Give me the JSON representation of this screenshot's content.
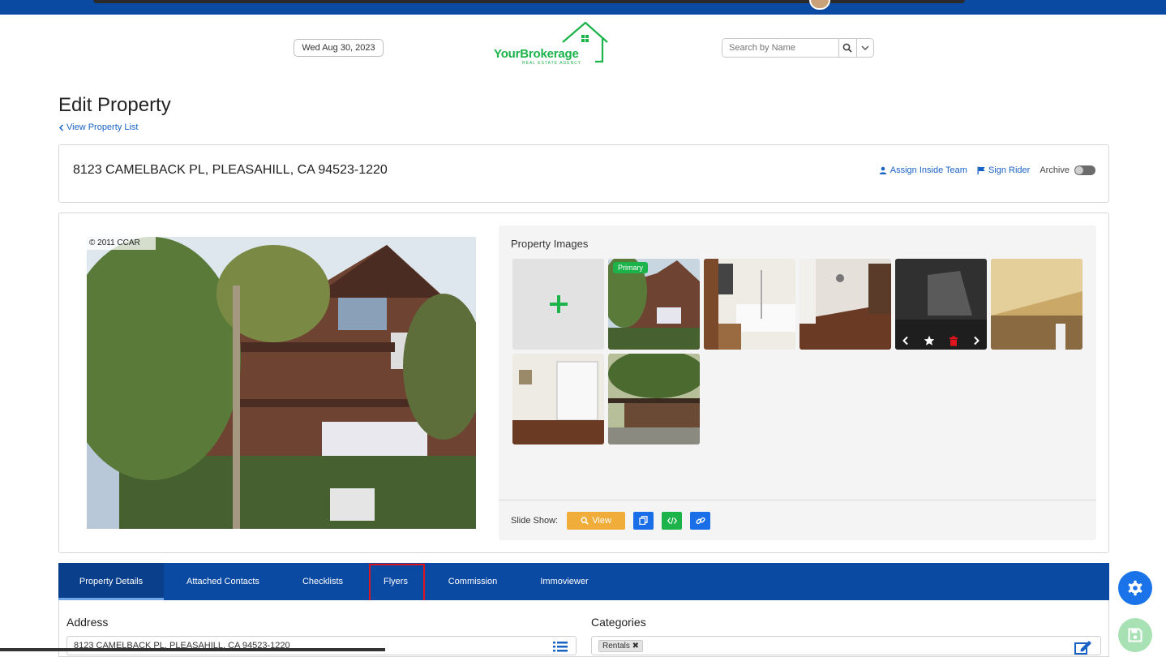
{
  "header": {
    "date": "Wed Aug 30, 2023",
    "logo_name": "YourBrokerage",
    "logo_sub": "REAL ESTATE AGENCY",
    "search_placeholder": "Search by Name"
  },
  "page": {
    "title": "Edit Property",
    "back_link": "View Property List"
  },
  "property": {
    "address": "8123 CAMELBACK PL, PLEASAHILL, CA 94523-1220",
    "actions": {
      "assign_team": "Assign Inside Team",
      "sign_rider": "Sign Rider",
      "archive": "Archive"
    },
    "photo_watermark": "© 2011 CCAR"
  },
  "images": {
    "label": "Property Images",
    "primary_badge": "Primary",
    "slideshow_label": "Slide Show:",
    "view_button": "View",
    "thumbnails": [
      {
        "name": "exterior",
        "primary": true
      },
      {
        "name": "bathroom"
      },
      {
        "name": "living-room"
      },
      {
        "name": "dark-interior",
        "hover": true
      },
      {
        "name": "attic-room"
      },
      {
        "name": "closet-room"
      },
      {
        "name": "balcony"
      }
    ]
  },
  "tabs": [
    {
      "label": "Property Details",
      "active": true
    },
    {
      "label": "Attached Contacts"
    },
    {
      "label": "Checklists"
    },
    {
      "label": "Flyers",
      "highlighted": true
    },
    {
      "label": "Commission"
    },
    {
      "label": "Immoviewer"
    }
  ],
  "details": {
    "address_label": "Address",
    "address_value": "8123 CAMELBACK PL, PLEASAHILL, CA 94523-1220",
    "categories_label": "Categories",
    "category_tag": "Rentals ✖"
  },
  "colors": {
    "brand_blue": "#0b4aa3",
    "brand_green": "#1bb34a",
    "link_blue": "#1a63c6",
    "view_orange": "#f0ad3a",
    "highlight_red": "#e0141c"
  }
}
